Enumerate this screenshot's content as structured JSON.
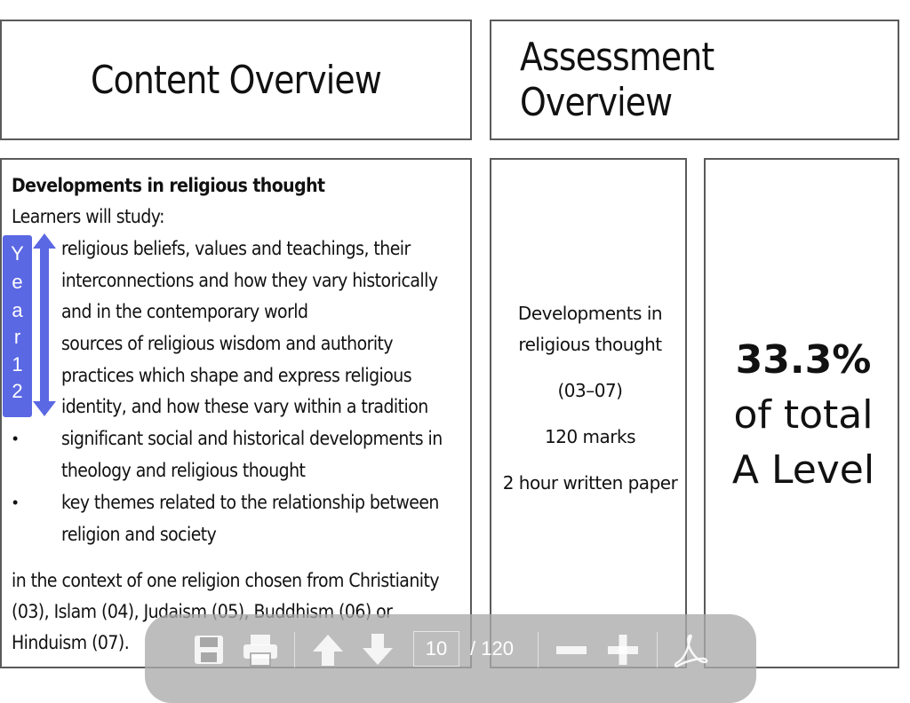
{
  "headers": {
    "content": "Content Overview",
    "assessment": "Assessment Overview"
  },
  "content": {
    "title": "Developments in religious thought",
    "intro": "Learners will study:",
    "lines": [
      "religious beliefs, values and teachings, their",
      "interconnections and how they vary historically",
      "and in the contemporary world",
      "sources of religious wisdom and authority",
      "practices which shape and express religious",
      "identity, and how these vary within a tradition",
      "significant social and historical developments in",
      "theology and religious thought",
      "key themes related to the relationship between",
      "religion and society"
    ],
    "bullet": "•",
    "context": [
      "in the context of one religion chosen from Christianity",
      "(03), Islam (04), Judaism (05), Buddhism (06) or",
      "Hinduism (07)."
    ],
    "year_badge": [
      "Y",
      "e",
      "a",
      "r",
      "1",
      "2"
    ]
  },
  "assessment": {
    "title_line1": "Developments in",
    "title_line2": "religious thought",
    "codes": "(03–07)",
    "marks": "120 marks",
    "paper": "2 hour written paper"
  },
  "weighting": {
    "percent": "33.3%",
    "line2": "of total",
    "line3": "A Level"
  },
  "toolbar": {
    "current_page": "10",
    "total_pages": "/ 120",
    "icons": [
      "save-icon",
      "print-icon",
      "previous-page-icon",
      "next-page-icon",
      "zoom-out-icon",
      "zoom-in-icon",
      "acrobat-icon"
    ]
  }
}
